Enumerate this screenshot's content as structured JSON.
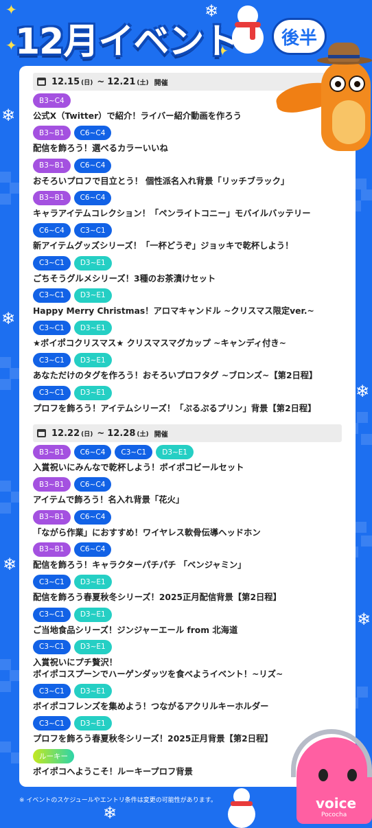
{
  "header": {
    "title": "12月イベント",
    "half_badge": "後半"
  },
  "weeks": [
    {
      "start": "12.15",
      "start_dow": "(日)",
      "separator": "~",
      "end": "12.21",
      "end_dow": "(土)",
      "held": "開催",
      "events": [
        {
          "tags": [
            {
              "label": "B3~C4",
              "color": "purple"
            }
          ],
          "title": "公式X（Twitter）で紹介！ライバー紹介動画を作ろう"
        },
        {
          "tags": [
            {
              "label": "B3~B1",
              "color": "purple"
            },
            {
              "label": "C6~C4",
              "color": "blue"
            }
          ],
          "title": "配信を飾ろう！選べるカラーいいね"
        },
        {
          "tags": [
            {
              "label": "B3~B1",
              "color": "purple"
            },
            {
              "label": "C6~C4",
              "color": "blue"
            }
          ],
          "title": "おそろいプロフで目立とう！ 個性派名入れ背景「リッチブラック」"
        },
        {
          "tags": [
            {
              "label": "B3~B1",
              "color": "purple"
            },
            {
              "label": "C6~C4",
              "color": "blue"
            }
          ],
          "title": "キャラアイテムコレクション！「ペンライトコニー」モバイルバッテリー"
        },
        {
          "tags": [
            {
              "label": "C6~C4",
              "color": "blue"
            },
            {
              "label": "C3~C1",
              "color": "blue"
            }
          ],
          "title": "新アイテムグッズシリーズ！「一杯どうぞ」ジョッキで乾杯しよう！"
        },
        {
          "tags": [
            {
              "label": "C3~C1",
              "color": "blue"
            },
            {
              "label": "D3~E1",
              "color": "cyan"
            }
          ],
          "title": "ごちそうグルメシリーズ！3種のお茶漬けセット"
        },
        {
          "tags": [
            {
              "label": "C3~C1",
              "color": "blue"
            },
            {
              "label": "D3~E1",
              "color": "cyan"
            }
          ],
          "title": "Happy Merry Christmas！アロマキャンドル ~クリスマス限定ver.~"
        },
        {
          "tags": [
            {
              "label": "C3~C1",
              "color": "blue"
            },
            {
              "label": "D3~E1",
              "color": "cyan"
            }
          ],
          "title": "★ボイポコクリスマス★ クリスマスマグカップ ~キャンディ付き~"
        },
        {
          "tags": [
            {
              "label": "C3~C1",
              "color": "blue"
            },
            {
              "label": "D3~E1",
              "color": "cyan"
            }
          ],
          "title": "あなただけのタグを作ろう！おそろいプロフタグ ~ブロンズ~【第2日程】"
        },
        {
          "tags": [
            {
              "label": "C3~C1",
              "color": "blue"
            },
            {
              "label": "D3~E1",
              "color": "cyan"
            }
          ],
          "title": "プロフを飾ろう！アイテムシリーズ！「ぷるぷるプリン」背景【第2日程】"
        }
      ]
    },
    {
      "start": "12.22",
      "start_dow": "(日)",
      "separator": "~",
      "end": "12.28",
      "end_dow": "(土)",
      "held": "開催",
      "events": [
        {
          "tags": [
            {
              "label": "B3~B1",
              "color": "purple"
            },
            {
              "label": "C6~C4",
              "color": "blue"
            },
            {
              "label": "C3~C1",
              "color": "blue"
            },
            {
              "label": "D3~E1",
              "color": "cyan"
            }
          ],
          "title": "入賞祝いにみんなで乾杯しよう！ボイポコビールセット"
        },
        {
          "tags": [
            {
              "label": "B3~B1",
              "color": "purple"
            },
            {
              "label": "C6~C4",
              "color": "blue"
            }
          ],
          "title": "アイテムで飾ろう！名入れ背景「花火」"
        },
        {
          "tags": [
            {
              "label": "B3~B1",
              "color": "purple"
            },
            {
              "label": "C6~C4",
              "color": "blue"
            }
          ],
          "title": "「ながら作業」におすすめ！ワイヤレス軟骨伝導ヘッドホン"
        },
        {
          "tags": [
            {
              "label": "B3~B1",
              "color": "purple"
            },
            {
              "label": "C6~C4",
              "color": "blue"
            }
          ],
          "title": "配信を飾ろう！キャラクターパチパチ 「ベンジャミン」"
        },
        {
          "tags": [
            {
              "label": "C3~C1",
              "color": "blue"
            },
            {
              "label": "D3~E1",
              "color": "cyan"
            }
          ],
          "title": "配信を飾ろう春夏秋冬シリーズ！2025正月配信背景【第2日程】"
        },
        {
          "tags": [
            {
              "label": "C3~C1",
              "color": "blue"
            },
            {
              "label": "D3~E1",
              "color": "cyan"
            }
          ],
          "title": "ご当地食品シリーズ！ジンジャーエール from 北海道"
        },
        {
          "tags": [
            {
              "label": "C3~C1",
              "color": "blue"
            },
            {
              "label": "D3~E1",
              "color": "cyan"
            }
          ],
          "title": "入賞祝いにプチ贅沢！",
          "title2": "ボイポコスプーンでハーゲンダッツを食べようイベント！~リズ~"
        },
        {
          "tags": [
            {
              "label": "C3~C1",
              "color": "blue"
            },
            {
              "label": "D3~E1",
              "color": "cyan"
            }
          ],
          "title": "ボイポコフレンズを集めよう！つながるアクリルキーホルダー"
        },
        {
          "tags": [
            {
              "label": "C3~C1",
              "color": "blue"
            },
            {
              "label": "D3~E1",
              "color": "cyan"
            }
          ],
          "title": "プロフを飾ろう春夏秋冬シリーズ！2025正月背景【第2日程】"
        },
        {
          "tags": [
            {
              "label": "ルーキー",
              "color": "rookie"
            }
          ],
          "title": "ボイポコへようこそ！ルーキープロフ背景"
        }
      ]
    }
  ],
  "footnote": "※ イベントのスケジュールやエントリ条件は変更の可能性があります。",
  "brand": {
    "logo": "voice",
    "logo_sub": "Pococha"
  },
  "colors": {
    "background": "#1d6ff0",
    "tag_purple": "#a451e0",
    "tag_blue": "#1262e6",
    "tag_cyan": "#25cfc4"
  }
}
